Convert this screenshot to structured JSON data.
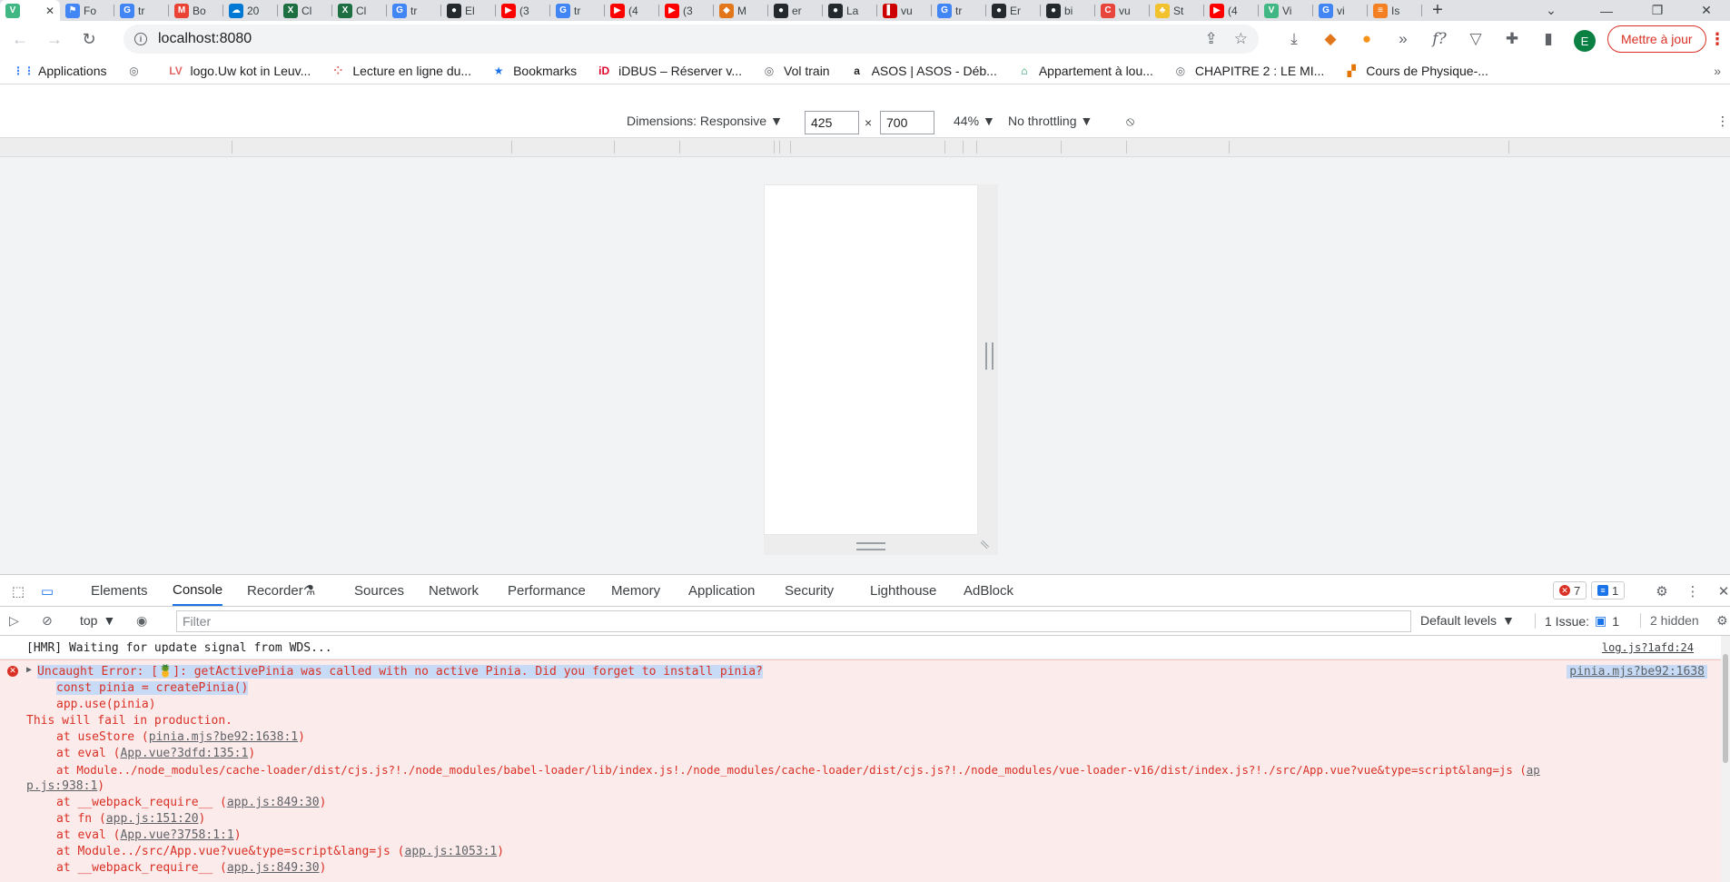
{
  "tabs": [
    {
      "title": "",
      "fav": "V",
      "color": "#41b883",
      "active": true
    },
    {
      "title": "Fo",
      "fav": "⚑",
      "color": "#4285f4"
    },
    {
      "title": "tr",
      "fav": "G",
      "color": "#4285f4"
    },
    {
      "title": "Bo",
      "fav": "M",
      "color": "#ea4335"
    },
    {
      "title": "20",
      "fav": "☁",
      "color": "#0078d4"
    },
    {
      "title": "Cl",
      "fav": "X",
      "color": "#1d6f42"
    },
    {
      "title": "Cl",
      "fav": "X",
      "color": "#1d6f42"
    },
    {
      "title": "tr",
      "fav": "G",
      "color": "#4285f4"
    },
    {
      "title": "El",
      "fav": "●",
      "color": "#24292e"
    },
    {
      "title": "(3",
      "fav": "▶",
      "color": "#ff0000"
    },
    {
      "title": "tr",
      "fav": "G",
      "color": "#4285f4"
    },
    {
      "title": "(4",
      "fav": "▶",
      "color": "#ff0000"
    },
    {
      "title": "(3",
      "fav": "▶",
      "color": "#ff0000"
    },
    {
      "title": "M",
      "fav": "◆",
      "color": "#e2761b"
    },
    {
      "title": "er",
      "fav": "●",
      "color": "#24292e"
    },
    {
      "title": "La",
      "fav": "●",
      "color": "#24292e"
    },
    {
      "title": "vu",
      "fav": "▌",
      "color": "#c00"
    },
    {
      "title": "tr",
      "fav": "G",
      "color": "#4285f4"
    },
    {
      "title": "Er",
      "fav": "●",
      "color": "#24292e"
    },
    {
      "title": "bi",
      "fav": "●",
      "color": "#24292e"
    },
    {
      "title": "vu",
      "fav": "C",
      "color": "#e8453c"
    },
    {
      "title": "St",
      "fav": "♣",
      "color": "#f2c12e"
    },
    {
      "title": "(4",
      "fav": "▶",
      "color": "#ff0000"
    },
    {
      "title": "Vi",
      "fav": "V",
      "color": "#41b883"
    },
    {
      "title": "vi",
      "fav": "G",
      "color": "#4285f4"
    },
    {
      "title": "Is",
      "fav": "≡",
      "color": "#f48024"
    }
  ],
  "toolbar": {
    "url": "localhost:8080",
    "update_label": "Mettre à jour",
    "avatar_letter": "E"
  },
  "bookmarks": [
    {
      "label": "Applications",
      "icon": "⋮⋮",
      "color": "#4285f4"
    },
    {
      "label": "",
      "icon": "◎",
      "color": "#5f6368"
    },
    {
      "label": "logo.Uw kot in Leuv...",
      "icon": "LV",
      "color": "#e06666"
    },
    {
      "label": "Lecture en ligne du...",
      "icon": "⁘",
      "color": "#e06666"
    },
    {
      "label": "Bookmarks",
      "icon": "★",
      "color": "#1a73e8"
    },
    {
      "label": "iDBUS – Réserver v...",
      "icon": "iD",
      "color": "#e2002a"
    },
    {
      "label": "Vol train",
      "icon": "◎",
      "color": "#5f6368"
    },
    {
      "label": "ASOS | ASOS - Déb...",
      "icon": "a",
      "color": "#202124"
    },
    {
      "label": "Appartement à lou...",
      "icon": "⌂",
      "color": "#0f9d58"
    },
    {
      "label": "CHAPITRE 2 : LE MI...",
      "icon": "◎",
      "color": "#5f6368"
    },
    {
      "label": "Cours de Physique-...",
      "icon": "▞",
      "color": "#e37400"
    }
  ],
  "device_toolbar": {
    "dimensions": "Dimensions: Responsive",
    "width": "425",
    "height": "700",
    "times": "×",
    "zoom": "44%",
    "throttling": "No throttling"
  },
  "devtools": {
    "tabs": [
      "Elements",
      "Console",
      "Recorder",
      "Sources",
      "Network",
      "Performance",
      "Memory",
      "Application",
      "Security",
      "Lighthouse",
      "AdBlock"
    ],
    "active_tab": "Console",
    "error_count": "7",
    "message_count": "1",
    "context": "top",
    "filter_placeholder": "Filter",
    "levels": "Default levels",
    "issues_label": "1 Issue:",
    "issues_count": "1",
    "hidden": "2 hidden"
  },
  "console": {
    "info_msg": "[HMR] Waiting for update signal from WDS...",
    "info_src": "log.js?1afd:24",
    "error_src": "pinia.mjs?be92:1638",
    "error_lines": [
      "Uncaught Error: [🍍]: getActivePinia was called with no active Pinia. Did you forget to install pinia?",
      "const pinia = createPinia()",
      "app.use(pinia)",
      "This will fail in production.",
      "at useStore (",
      "at eval (",
      "at Module../node_modules/cache-loader/dist/cjs.js?!./node_modules/babel-loader/lib/index.js!./node_modules/cache-loader/dist/cjs.js?!./node_modules/vue-loader-v16/dist/index.js?!./src/App.vue?vue&type=script&lang=js (",
      "at __webpack_require__ (",
      "at fn (",
      "at eval (",
      "at Module../src/App.vue?vue&type=script&lang=js (",
      "at __webpack_require__ ("
    ],
    "error_links": [
      "pinia.mjs?be92:1638:1",
      "App.vue?3dfd:135:1",
      "ap",
      "p.js:938:1",
      "app.js:849:30",
      "app.js:151:20",
      "App.vue?3758:1:1",
      "app.js:1053:1",
      "app.js:849:30"
    ]
  }
}
